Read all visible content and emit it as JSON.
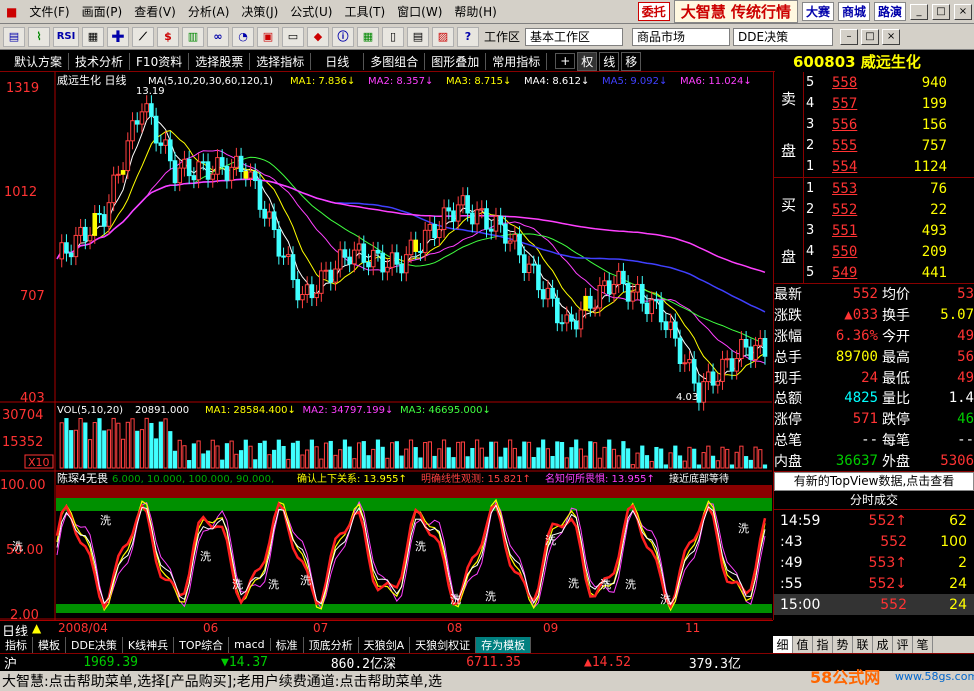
{
  "menu": {
    "items": [
      "文件(F)",
      "画面(P)",
      "查看(V)",
      "分析(A)",
      "决策(J)",
      "公式(U)",
      "工具(T)",
      "窗口(W)",
      "帮助(H)"
    ],
    "entrust": "委托",
    "brand": "大智慧 传统行情",
    "links": [
      "大赛",
      "商城",
      "路演"
    ],
    "win": [
      "_",
      "□",
      "×"
    ]
  },
  "toolbar": {
    "icons": [
      "open-icon",
      "chart-icon",
      "rsi-icon",
      "calc-icon",
      "plus-icon",
      "ruler-icon",
      "dollar-icon",
      "bars-icon",
      "binoculars-icon",
      "gauge-icon",
      "save-icon",
      "doc-icon",
      "diamond-icon",
      "info-icon",
      "grid-icon",
      "book-icon",
      "doc2-icon",
      "compare-icon",
      "help-icon"
    ],
    "workspace_label": "工作区",
    "workspace_value": "基本工作区",
    "market": "商品市场",
    "dde": "DDE决策"
  },
  "subtoolbar": {
    "items": [
      "默认方案",
      "技术分析",
      "F10资料",
      "选择股票",
      "选择指标",
      "日线",
      "多图组合",
      "图形叠加",
      "常用指标"
    ],
    "small": [
      "+",
      "权",
      "线",
      "移"
    ]
  },
  "header": {
    "code": "600803",
    "name": "威远生化"
  },
  "chart_data": [
    {
      "type": "candlestick",
      "title": "威远生化 日线",
      "ma_legend": "MA(5,10,20,30,60,120,1)",
      "ma_values": [
        {
          "name": "MA1",
          "value": "7.836↓"
        },
        {
          "name": "MA2",
          "value": "8.357↓"
        },
        {
          "name": "MA3",
          "value": "8.715↓"
        },
        {
          "name": "MA4",
          "value": "8.612↓"
        },
        {
          "name": "MA5",
          "value": "9.092↓"
        },
        {
          "name": "MA6",
          "value": "11.024↓"
        }
      ],
      "y_ticks": [
        "1319",
        "1012",
        "707",
        "403"
      ],
      "annotations": [
        "13.19",
        "4.03"
      ],
      "ylim": [
        4.03,
        13.19
      ]
    },
    {
      "type": "bar",
      "title": "VOL(5,10,20)",
      "value": "20891.000",
      "ma_values": [
        {
          "name": "MA1",
          "value": "28584.400↓"
        },
        {
          "name": "MA2",
          "value": "34797.199↓"
        },
        {
          "name": "MA3",
          "value": "46695.000↓"
        }
      ],
      "y_ticks": [
        "30704",
        "15352",
        "X10"
      ]
    },
    {
      "type": "line",
      "title": "陈琛4无畏",
      "params": "6.000, 10.000, 100.000, 90.000,",
      "labels": [
        {
          "text": "确认上下关系: 13.955↑",
          "color": "#ffff00"
        },
        {
          "text": "明确线性观测: 15.821↑",
          "color": "#ff4040"
        },
        {
          "text": "名知何所畏惧: 13.955↑",
          "color": "#ff40ff"
        },
        {
          "text": "接近底部等待",
          "color": "#ffffff"
        }
      ],
      "y_ticks": [
        "100.00",
        "50.00",
        "2.00"
      ],
      "markers": [
        "洗",
        "洗",
        "洗",
        "洗",
        "洗",
        "洗",
        "洗",
        "洗",
        "洗",
        "洗",
        "洗",
        "洗",
        "洗",
        "洗",
        "洗"
      ]
    }
  ],
  "timeline": {
    "label": "日线",
    "dates": [
      "2008/04",
      "06",
      "07",
      "08",
      "09",
      "11"
    ]
  },
  "orderbook": {
    "sell_side": "卖盘",
    "buy_side": "买盘",
    "sells": [
      {
        "lv": "5",
        "price": "558",
        "vol": "940"
      },
      {
        "lv": "4",
        "price": "557",
        "vol": "199"
      },
      {
        "lv": "3",
        "price": "556",
        "vol": "156"
      },
      {
        "lv": "2",
        "price": "555",
        "vol": "757"
      },
      {
        "lv": "1",
        "price": "554",
        "vol": "1124"
      }
    ],
    "buys": [
      {
        "lv": "1",
        "price": "553",
        "vol": "76"
      },
      {
        "lv": "2",
        "price": "552",
        "vol": "22"
      },
      {
        "lv": "3",
        "price": "551",
        "vol": "493"
      },
      {
        "lv": "4",
        "price": "550",
        "vol": "209"
      },
      {
        "lv": "5",
        "price": "549",
        "vol": "441"
      }
    ]
  },
  "quotes": [
    {
      "l": "最新",
      "v": "552",
      "vc": "red",
      "r": "均价",
      "v2": "53",
      "v2c": "red"
    },
    {
      "l": "涨跌",
      "v": "▲033",
      "vc": "red",
      "r": "换手",
      "v2": "5.07",
      "v2c": "yel"
    },
    {
      "l": "涨幅",
      "v": "6.36%",
      "vc": "red",
      "r": "今开",
      "v2": "49",
      "v2c": "red"
    },
    {
      "l": "总手",
      "v": "89700",
      "vc": "yel",
      "r": "最高",
      "v2": "56",
      "v2c": "red"
    },
    {
      "l": "现手",
      "v": "24",
      "vc": "red",
      "r": "最低",
      "v2": "49",
      "v2c": "red"
    },
    {
      "l": "总额",
      "v": "4825",
      "vc": "cyan",
      "r": "量比",
      "v2": "1.4",
      "v2c": "wht"
    },
    {
      "l": "涨停",
      "v": "571",
      "vc": "red",
      "r": "跌停",
      "v2": "46",
      "v2c": "grn"
    },
    {
      "l": "总笔",
      "v": "--",
      "vc": "wht",
      "r": "每笔",
      "v2": "--",
      "v2c": "wht"
    },
    {
      "l": "内盘",
      "v": "36637",
      "vc": "grn",
      "r": "外盘",
      "v2": "5306",
      "v2c": "red"
    }
  ],
  "notice": "有新的TopView数据,点击查看",
  "trades": {
    "title": "分时成交",
    "rows": [
      {
        "t": "14:59",
        "p": "552↑",
        "v": "62"
      },
      {
        "t": ":43",
        "p": "552",
        "v": "100"
      },
      {
        "t": ":49",
        "p": "553↑",
        "v": "2"
      },
      {
        "t": ":55",
        "p": "552↓",
        "v": "24"
      },
      {
        "t": "15:00",
        "p": "552",
        "v": "24"
      }
    ]
  },
  "right_tabs": [
    "细",
    "值",
    "指",
    "势",
    "联",
    "成",
    "评",
    "笔"
  ],
  "bottom_tabs": [
    "指标",
    "模板",
    "DDE决策",
    "K线神兵",
    "TOP综合",
    "macd",
    "标准",
    "顶底分析",
    "天狼剑A",
    "天狼剑权证",
    "存为模板"
  ],
  "status": {
    "sh_label": "沪",
    "sh_index": "1969.39",
    "sh_chg": "▼14.37",
    "sh_amt": "860.2亿",
    "sz_label": "深",
    "sz_index": "6711.35",
    "sz_chg": "▲14.52",
    "sz_amt": "379.3亿"
  },
  "scroll_msg": "大智慧:点击帮助菜单,选择[产品购买];老用户续费通道:点击帮助菜单,选",
  "watermark": {
    "brand": "58公式网",
    "url": "www.58gs.com"
  }
}
